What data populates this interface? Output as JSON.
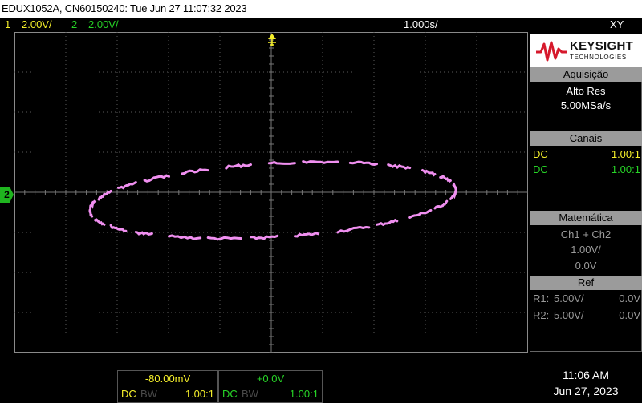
{
  "title_bar": "EDUX1052A, CN60150240: Tue Jun 27 11:07:32 2023",
  "status": {
    "ch1_num": "1",
    "ch1_scale": "2.00V/",
    "ch2_num": "2",
    "ch2_scale": "2.00V/",
    "timebase": "1.000s/",
    "mode": "XY"
  },
  "markers": {
    "ch2": "2",
    "trigger": "T"
  },
  "panel": {
    "logo_name": "KEYSIGHT",
    "logo_sub": "TECHNOLOGIES",
    "acquisition": {
      "header": "Aquisição",
      "mode": "Alto Res",
      "rate": "5.00MSa/s"
    },
    "channels": {
      "header": "Canais",
      "rows": [
        {
          "coupling": "DC",
          "probe": "1.00:1",
          "color": "#f5ef2a"
        },
        {
          "coupling": "DC",
          "probe": "1.00:1",
          "color": "#27d427"
        }
      ]
    },
    "math": {
      "header": "Matemática",
      "function": "Ch1 + Ch2",
      "scale": "1.00V/",
      "offset": "0.0V"
    },
    "ref": {
      "header": "Ref",
      "rows": [
        {
          "name": "R1:",
          "scale": "5.00V/",
          "offset": "0.0V"
        },
        {
          "name": "R2:",
          "scale": "5.00V/",
          "offset": "0.0V"
        }
      ]
    }
  },
  "bottom": {
    "ch1": {
      "offset": "-80.00mV",
      "coupling": "DC",
      "bw": "BW",
      "probe": "1.00:1"
    },
    "ch2": {
      "offset": "+0.0V",
      "coupling": "DC",
      "bw": "BW",
      "probe": "1.00:1"
    },
    "time": "11:06 AM",
    "date": "Jun 27, 2023"
  },
  "colors": {
    "trace": "#f08ff0",
    "ch1": "#f5ef2a",
    "ch2": "#27d427",
    "grid": "#5a5a5a"
  }
}
